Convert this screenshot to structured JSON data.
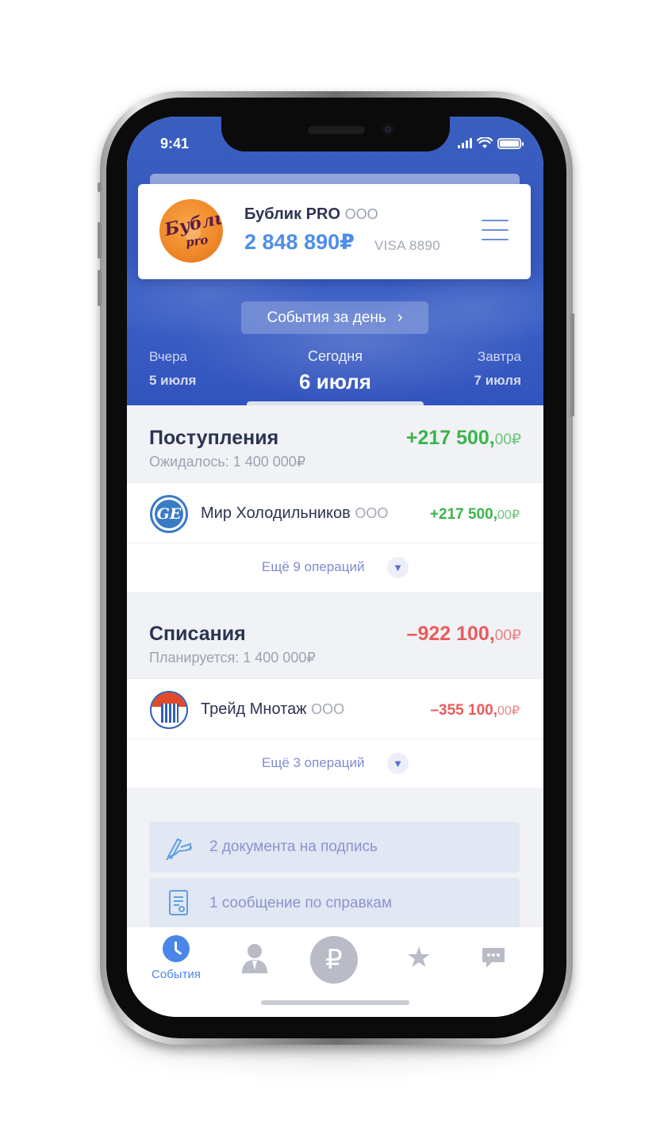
{
  "status_bar": {
    "time": "9:41"
  },
  "account": {
    "company_name": "Бублик PRO",
    "company_form": "ООО",
    "balance": "2 848 890₽",
    "card": "VISA 8890",
    "logo_text": "Бублик",
    "logo_sub": "pro"
  },
  "events_button": {
    "label": "События за день",
    "chevron": "›"
  },
  "days": {
    "prev": {
      "label": "Вчера",
      "date": "5 июля"
    },
    "today": {
      "label": "Сегодня",
      "date": "6 июля"
    },
    "next": {
      "label": "Завтра",
      "date": "7 июля"
    }
  },
  "income": {
    "title": "Поступления",
    "subtitle": "Ожидалось: 1 400 000₽",
    "amount": "+217 500,",
    "amount_kop": "00₽",
    "color": "#3bb54a",
    "operation": {
      "name": "Мир Холодильников",
      "form": "ООО",
      "amount": "+217 500,",
      "kop": "00₽",
      "logo_text": "GE"
    },
    "more": "Ещё 9 операций"
  },
  "expense": {
    "title": "Списания",
    "subtitle": "Планируется: 1 400 000₽",
    "amount": "–922 100,",
    "amount_kop": "00₽",
    "color": "#ea5b5b",
    "operation": {
      "name": "Трейд Мнотаж",
      "form": "ООО",
      "amount": "–355 100,",
      "kop": "00₽"
    },
    "more": "Ещё 3 операций"
  },
  "notices": [
    {
      "icon": "signature-icon",
      "text": "2 документа на подпись"
    },
    {
      "icon": "document-icon",
      "text": "1 сообщение по справкам"
    }
  ],
  "tabbar": {
    "events_label": "События",
    "rub_symbol": "₽",
    "star_symbol": "★",
    "accent": "#4a86e8"
  }
}
